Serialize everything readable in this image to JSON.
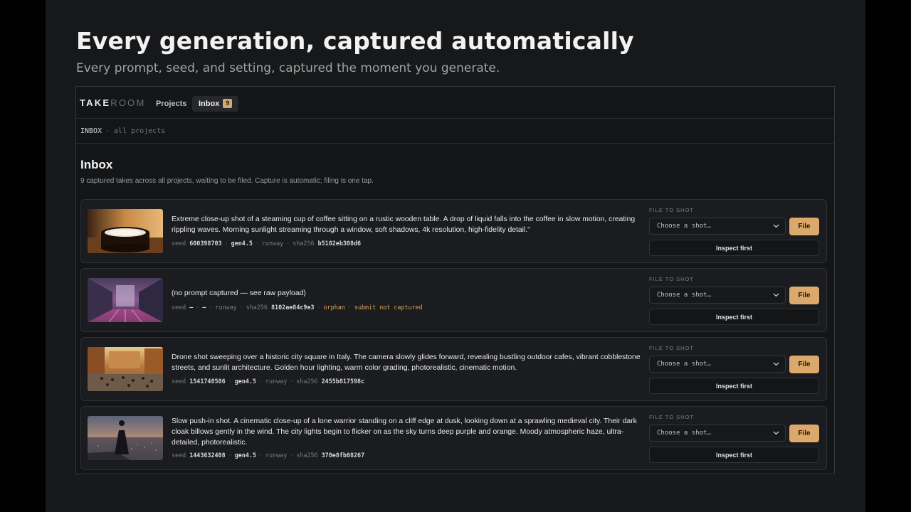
{
  "hero": {
    "title": "Every generation, captured automatically",
    "subtitle": "Every prompt, seed, and setting, captured the moment you generate."
  },
  "app": {
    "logo_bold": "TAKE",
    "logo_light": "ROOM",
    "nav": {
      "projects": "Projects",
      "inbox": "Inbox",
      "inbox_count": "9"
    },
    "breadcrumb": {
      "main": "INBOX",
      "sep": "·",
      "sub": "all projects"
    },
    "page_title": "Inbox",
    "page_desc": "9 captured takes across all projects, waiting to be filed. Capture is automatic; filing is one tap.",
    "file_label": "FILE TO SHOT",
    "select_placeholder": "Choose a shot…",
    "file_button": "File",
    "inspect_button": "Inspect first",
    "seed_label": "seed",
    "hash_label": "sha256",
    "sep": "·",
    "takes": [
      {
        "prompt": "Extreme close-up shot of a steaming cup of coffee sitting on a rustic wooden table. A drop of liquid falls into the coffee in slow motion, creating rippling waves. Morning sunlight streaming through a window, soft shadows, 4k resolution, high-fidelity detail.\"",
        "seed": "600398703",
        "model": "gen4.5",
        "provider": "runway",
        "hash": "b5102eb308d6",
        "thumb": "coffee-thumbnail"
      },
      {
        "prompt": "(no prompt captured — see raw payload)",
        "seed": "—",
        "model": "—",
        "provider": "runway",
        "hash": "8102ae84c9e3",
        "flag1": "orphan",
        "flag2": "submit not captured",
        "thumb": "neon-street-thumbnail"
      },
      {
        "prompt": "Drone shot sweeping over a historic city square in Italy. The camera slowly glides forward, revealing bustling outdoor cafes, vibrant cobblestone streets, and sunlit architecture. Golden hour lighting, warm color grading, photorealistic, cinematic motion.",
        "seed": "1541748506",
        "model": "gen4.5",
        "provider": "runway",
        "hash": "2455b817598c",
        "thumb": "city-square-thumbnail"
      },
      {
        "prompt": "Slow push-in shot. A cinematic close-up of a lone warrior standing on a cliff edge at dusk, looking down at a sprawling medieval city. Their dark cloak billows gently in the wind. The city lights begin to flicker on as the sky turns deep purple and orange. Moody atmospheric haze, ultra-detailed, photorealistic.",
        "seed": "1443632408",
        "model": "gen4.5",
        "provider": "runway",
        "hash": "370e8fb08267",
        "thumb": "warrior-thumbnail"
      }
    ]
  },
  "colors": {
    "accent": "#dca86b",
    "background": "#17181a",
    "warn": "#d8a25c"
  }
}
